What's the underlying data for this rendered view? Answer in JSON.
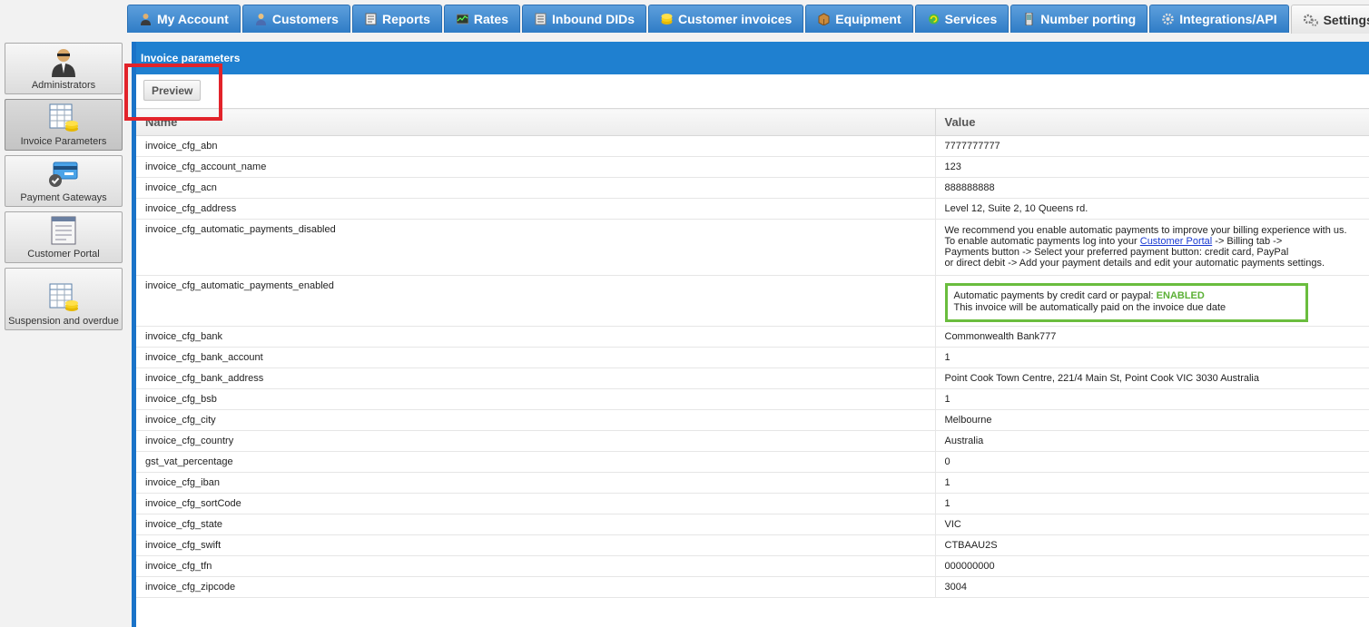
{
  "nav": {
    "tabs": [
      {
        "label": "My Account",
        "icon": "person-icon"
      },
      {
        "label": "Customers",
        "icon": "customer-icon"
      },
      {
        "label": "Reports",
        "icon": "reports-icon"
      },
      {
        "label": "Rates",
        "icon": "rates-icon"
      },
      {
        "label": "Inbound DIDs",
        "icon": "list-icon"
      },
      {
        "label": "Customer invoices",
        "icon": "coins-icon"
      },
      {
        "label": "Equipment",
        "icon": "box-icon"
      },
      {
        "label": "Services",
        "icon": "refresh-icon"
      },
      {
        "label": "Number porting",
        "icon": "phone-icon"
      },
      {
        "label": "Integrations/API",
        "icon": "gear-icon"
      },
      {
        "label": "Settings",
        "icon": "gears-icon",
        "active": true
      }
    ]
  },
  "sidebar": {
    "items": [
      {
        "label": "Administrators",
        "icon": "admin-icon"
      },
      {
        "label": "Invoice Parameters",
        "icon": "invoice-icon",
        "active": true
      },
      {
        "label": "Payment Gateways",
        "icon": "payment-card-icon"
      },
      {
        "label": "Customer Portal",
        "icon": "portal-icon"
      },
      {
        "label": "Suspension and overdue",
        "icon": "suspension-icon"
      }
    ]
  },
  "main": {
    "title": "Invoice parameters",
    "preview_label": "Preview",
    "columns": {
      "name": "Name",
      "value": "Value"
    },
    "rows": [
      {
        "name": "invoice_cfg_abn",
        "value": "7777777777"
      },
      {
        "name": "invoice_cfg_account_name",
        "value": "123"
      },
      {
        "name": "invoice_cfg_acn",
        "value": "888888888"
      },
      {
        "name": "invoice_cfg_address",
        "value": "Level 12, Suite 2, 10 Queens rd."
      }
    ],
    "auto_disabled": {
      "name": "invoice_cfg_automatic_payments_disabled",
      "line1": "We recommend you enable automatic payments to improve your billing experience with us.",
      "line2_pre": "To enable automatic payments log into your ",
      "line2_link": "Customer Portal",
      "line2_post": " -> Billing tab ->",
      "line3": "Payments button -> Select your preferred payment button: credit card, PayPal",
      "line4": "or direct debit -> Add your payment details and edit your automatic payments settings."
    },
    "auto_enabled": {
      "name": "invoice_cfg_automatic_payments_enabled",
      "line1_pre": "Automatic payments by credit card or paypal: ",
      "line1_status": "ENABLED",
      "line2": "This invoice will be automatically paid on the invoice due date"
    },
    "rows2": [
      {
        "name": "invoice_cfg_bank",
        "value": "Commonwealth Bank777"
      },
      {
        "name": "invoice_cfg_bank_account",
        "value": "1"
      },
      {
        "name": "invoice_cfg_bank_address",
        "value": "Point Cook Town Centre, 221/4 Main St, Point Cook VIC 3030 Australia"
      },
      {
        "name": "invoice_cfg_bsb",
        "value": "1"
      },
      {
        "name": "invoice_cfg_city",
        "value": "Melbourne"
      },
      {
        "name": "invoice_cfg_country",
        "value": "Australia"
      },
      {
        "name": "gst_vat_percentage",
        "value": "0"
      },
      {
        "name": "invoice_cfg_iban",
        "value": "1"
      },
      {
        "name": "invoice_cfg_sortCode",
        "value": "1"
      },
      {
        "name": "invoice_cfg_state",
        "value": "VIC"
      },
      {
        "name": "invoice_cfg_swift",
        "value": "CTBAAU2S"
      },
      {
        "name": "invoice_cfg_tfn",
        "value": "000000000"
      },
      {
        "name": "invoice_cfg_zipcode",
        "value": "3004"
      }
    ]
  },
  "colors": {
    "nav_tab": "#2f7cc6",
    "header": "#1f80d0",
    "highlight_red": "#e2232a",
    "highlight_green": "#6abd3e",
    "enabled_text": "#5bb035"
  }
}
